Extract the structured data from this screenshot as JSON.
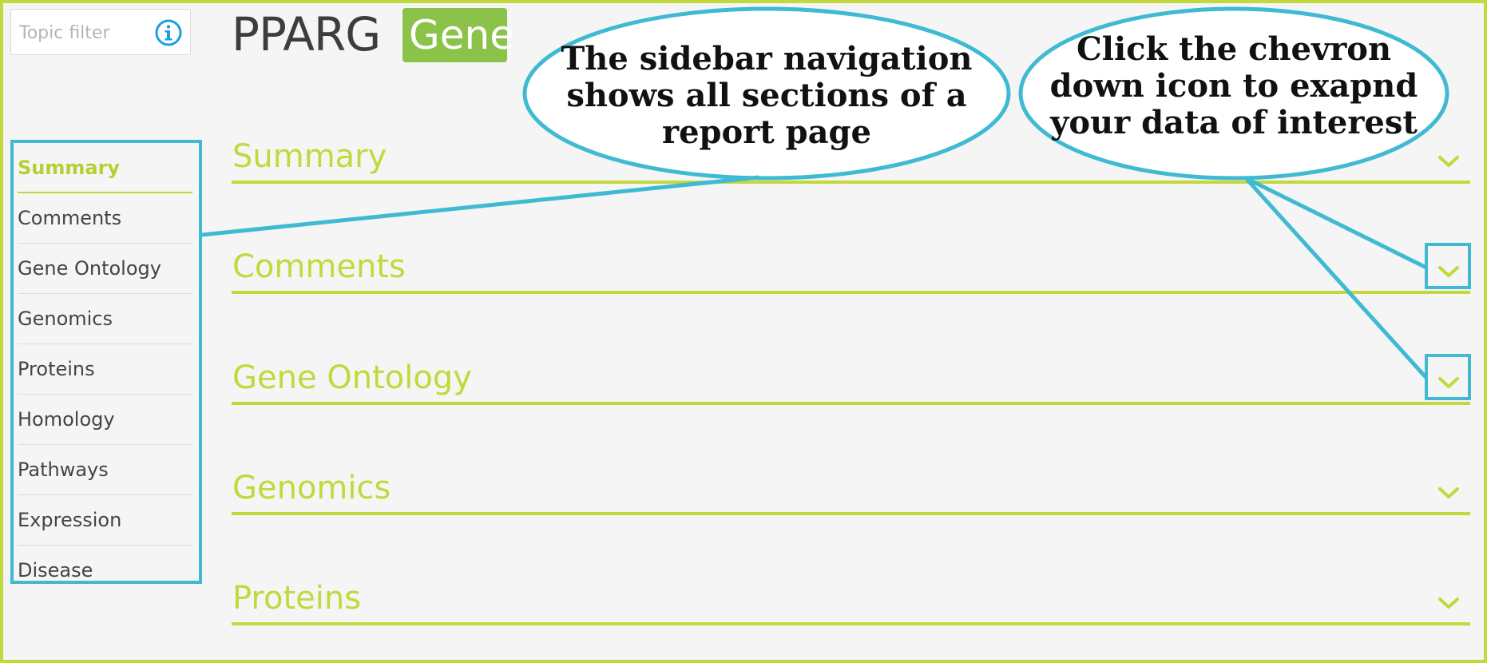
{
  "topic_filter": {
    "placeholder": "Topic filter",
    "icon": "info-icon"
  },
  "header": {
    "title": "PPARG",
    "badge": "Gene"
  },
  "sidebar": {
    "items": [
      {
        "label": "Summary",
        "active": true
      },
      {
        "label": "Comments"
      },
      {
        "label": "Gene Ontology"
      },
      {
        "label": "Genomics"
      },
      {
        "label": "Proteins"
      },
      {
        "label": "Homology"
      },
      {
        "label": "Pathways"
      },
      {
        "label": "Expression"
      },
      {
        "label": "Disease"
      }
    ]
  },
  "sections": [
    {
      "label": "Summary",
      "icon": "chevron-down-icon"
    },
    {
      "label": "Comments",
      "icon": "chevron-down-icon"
    },
    {
      "label": "Gene Ontology",
      "icon": "chevron-down-icon"
    },
    {
      "label": "Genomics",
      "icon": "chevron-down-icon"
    },
    {
      "label": "Proteins",
      "icon": "chevron-down-icon"
    }
  ],
  "annotations": {
    "sidebar_note": "The sidebar navigation shows all sections of a report page",
    "chevron_note": "Click the chevron down icon to exapnd your data of interest"
  },
  "colors": {
    "accent_green": "#c3d83a",
    "badge_green": "#8bc34a",
    "annotation_blue": "#3fbad2",
    "info_blue": "#1aa0e0"
  }
}
